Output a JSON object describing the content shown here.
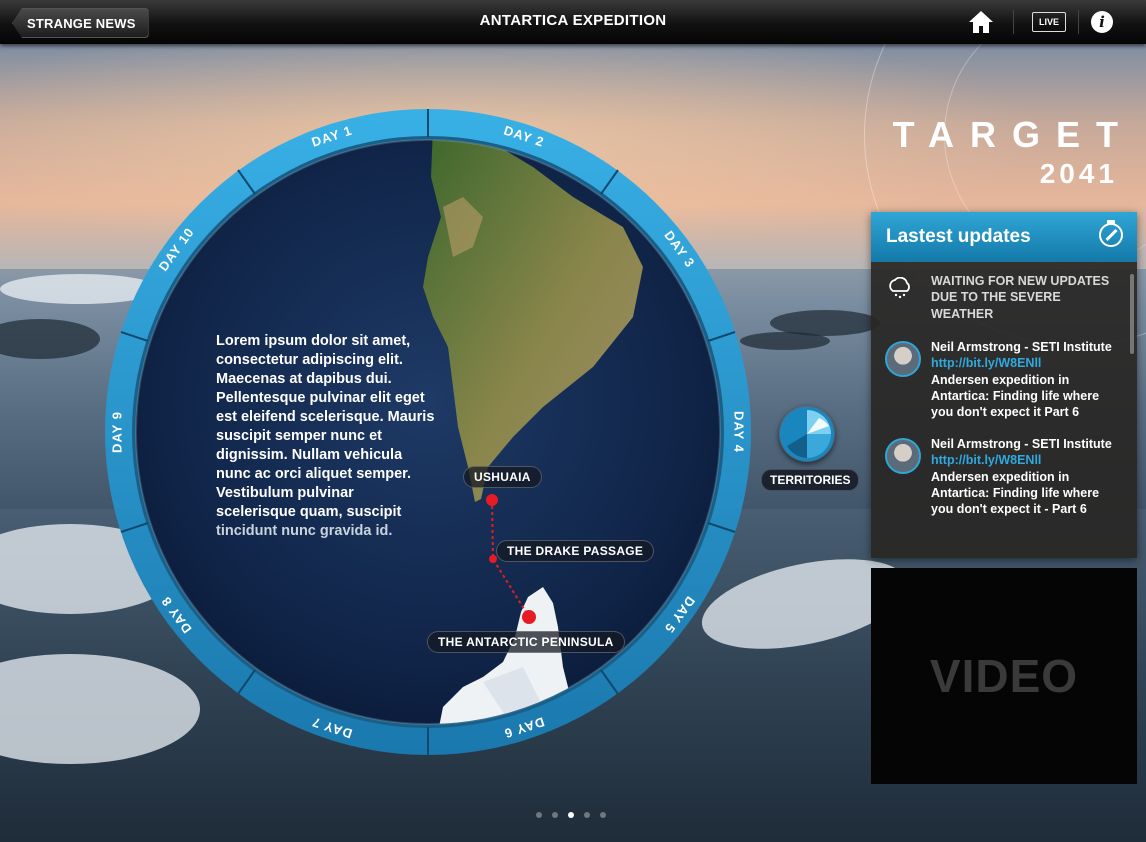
{
  "topbar": {
    "back_label": "STRANGE NEWS",
    "title": "ANTARTICA EXPEDITION",
    "live_label": "LIVE",
    "info_label": "i"
  },
  "dial": {
    "days": [
      "DAY 1",
      "DAY 2",
      "DAY 3",
      "DAY 4",
      "DAY 5",
      "DAY 6",
      "DAY 7",
      "DAY 8",
      "DAY 9",
      "DAY 10"
    ],
    "accent": "#2b9ad1",
    "ring_color": "#1d6f9f"
  },
  "map": {
    "text_main": "Lorem ipsum dolor sit amet, consectetur adipiscing elit. Maecenas at dapibus dui. Pellentesque pulvinar elit eget est eleifend scelerisque. Mauris suscipit semper nunc et dignissim. Nullam vehicula nunc ac orci aliquet semper. Vestibulum pulvinar scelerisque quam, suscipit",
    "text_dim": "tincidunt nunc gravida id.",
    "places": {
      "ushuaia": "USHUAIA",
      "drake": "THE DRAKE PASSAGE",
      "peninsula": "THE ANTARCTIC PENINSULA"
    },
    "route_color": "#e51c23"
  },
  "territories": {
    "label": "TERRITORIES"
  },
  "brand": {
    "line1": "TARGET",
    "line2": "2041"
  },
  "updates": {
    "title": "Lastest updates",
    "items": [
      {
        "icon": "cloud-icon",
        "text": "WAITING FOR NEW UPDATES DUE TO THE SEVERE WEATHER"
      },
      {
        "icon": "avatar",
        "author": "Neil Armstrong - SETI Institute",
        "link": "http://bit.ly/W8ENll",
        "text": "Andersen expedition in Antartica: Finding life where you don't expect it  Part 6"
      },
      {
        "icon": "avatar",
        "author": "Neil Armstrong - SETI Institute",
        "link": "http://bit.ly/W8ENll",
        "text": "Andersen expedition in Antartica: Finding life where you don't expect it - Part 6"
      }
    ]
  },
  "video": {
    "label": "VIDEO"
  },
  "pager": {
    "count": 5,
    "active": 3
  }
}
